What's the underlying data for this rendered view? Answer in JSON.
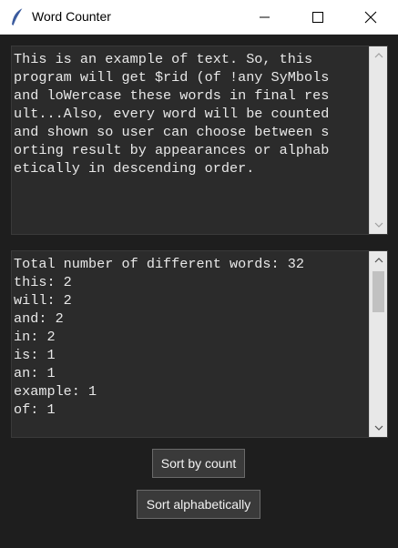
{
  "window": {
    "title": "Word Counter",
    "icons": {
      "app": "feather-icon",
      "minimize": "minimize-icon",
      "maximize": "maximize-icon",
      "close": "close-icon"
    }
  },
  "input_text": {
    "lines": [
      "This is an example of text. So, this",
      "program will get $rid (of !any SyMbols",
      "and loWercase these words in final res",
      "ult...Also, every word will be counted",
      "and shown so user can choose between s",
      "orting result by appearances or alphab",
      "etically in descending order."
    ]
  },
  "output": {
    "summary": "Total number of different words: 32",
    "words": [
      "this: 2",
      "will: 2",
      "and: 2",
      "in: 2",
      "is: 1",
      "an: 1",
      "example: 1",
      "of: 1"
    ],
    "scroll_position": 0.1
  },
  "buttons": {
    "sort_by_count": "Sort by count",
    "sort_alphabetically": "Sort alphabetically"
  }
}
